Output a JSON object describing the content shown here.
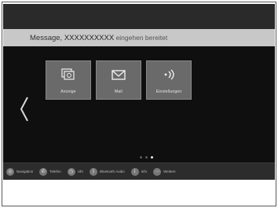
{
  "banner": {
    "message_prefix": "Message, ",
    "message_name": "XXXXXXXXXX",
    "message_suffix": " eingehen bereitet"
  },
  "tiles": [
    {
      "label": "Anzeige",
      "icon": "stacked-screens-icon"
    },
    {
      "label": "Mail",
      "icon": "envelope-icon"
    },
    {
      "label": "Einstellungen",
      "icon": "sound-settings-icon"
    }
  ],
  "pagination": {
    "total": 3,
    "active_index": 2
  },
  "bottom_bar": [
    {
      "label": "Navigation",
      "icon": "navigation-icon"
    },
    {
      "label": "Telefon",
      "icon": "phone-icon"
    },
    {
      "label": "Uhr",
      "icon": "clock-icon"
    },
    {
      "label": "Bluetooth Audio",
      "icon": "bluetooth-icon"
    },
    {
      "label": "Info",
      "icon": "info-icon"
    },
    {
      "label": "Weitere",
      "icon": "more-icon"
    }
  ],
  "colors": {
    "screen": "#2a2a2a",
    "content": "#0f0f0f",
    "banner": "#c8c8c8",
    "tile": "#6a6a6a"
  }
}
